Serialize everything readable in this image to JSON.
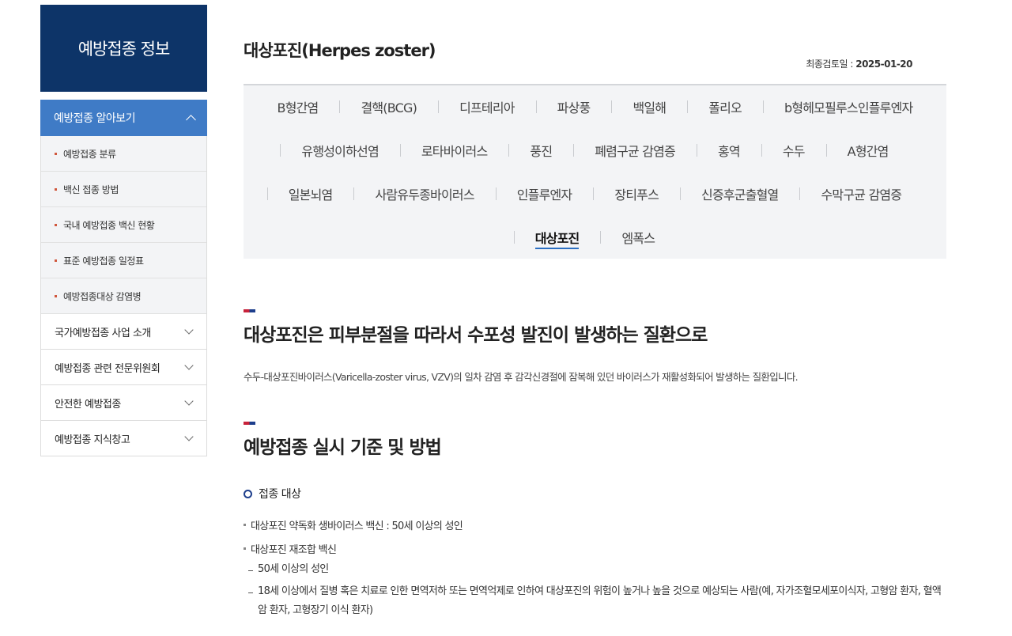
{
  "sidebar": {
    "title": "예방접종 정보",
    "active": {
      "label": "예방접종 알아보기"
    },
    "sub_items": [
      "예방접종 분류",
      "백신 접종 방법",
      "국내 예방접종 백신 현황",
      "표준 예방접종 일정표",
      "예방접종대상 감염병"
    ],
    "menu_items": [
      "국가예방접종 사업 소개",
      "예방접종 관련 전문위원회",
      "안전한 예방접종",
      "예방접종 지식창고"
    ]
  },
  "page": {
    "title": "대상포진(Herpes zoster)",
    "review_label": "최종검토일 :",
    "review_date": "2025-01-20"
  },
  "tabs": {
    "row1": [
      "B형간염",
      "결핵(BCG)",
      "디프테리아",
      "파상풍",
      "백일해",
      "폴리오",
      "b형헤모필루스인플루엔자"
    ],
    "row2": [
      "유행성이하선염",
      "로타바이러스",
      "풍진",
      "폐렴구균 감염증",
      "홍역",
      "수두",
      "A형간염"
    ],
    "row3": [
      "일본뇌염",
      "사람유두종바이러스",
      "인플루엔자",
      "장티푸스",
      "신증후군출혈열",
      "수막구균 감염증"
    ],
    "row4": [
      "대상포진",
      "엠폭스"
    ]
  },
  "section1": {
    "heading": "대상포진은 피부분절을 따라서 수포성 발진이 발생하는 질환으로",
    "body": "수두-대상포진바이러스(Varicella-zoster virus, VZV)의 일차 감염 후 감각신경절에 잠복해 있던 바이러스가 재활성화되어 발생하는 질환입니다."
  },
  "section2": {
    "heading": "예방접종 실시 기준 및 방법",
    "subheading": "접종 대상",
    "bullet1": "대상포진 약독화 생바이러스 백신 : 50세 이상의 성인",
    "bullet2": "대상포진 재조합 백신",
    "dash1": "50세 이상의 성인",
    "dash2": "18세 이상에서 질병 혹은 치료로 인한 면역저하 또는 면역억제로 인하여 대상포진의 위험이 높거나 높을 것으로 예상되는 사람(예, 자가조혈모세포이식자, 고형암 환자, 혈액암 환자, 고형장기 이식 환자)"
  },
  "colors": {
    "sidebar_head": "#0d3468",
    "sidebar_active": "#3f7bc6",
    "tab_bg": "#f3f4f6",
    "accent_underline": "#2b6fc2"
  }
}
